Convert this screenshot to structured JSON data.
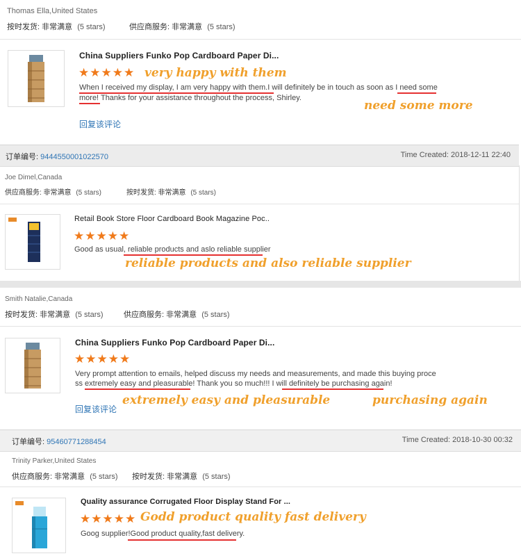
{
  "review1": {
    "user": "Thomas Ella,United States",
    "meta_a_label": "按时发货: 非常满意",
    "meta_a_stars": "(5 stars)",
    "meta_b_label": "供应商服务: 非常满意",
    "meta_b_stars": "(5 stars)",
    "product_title": "China Suppliers Funko Pop Cardboard Paper Di...",
    "stars": "★★★★★",
    "review_line1": "When I received my display, I am very happy with them.I will definitely be in touch as soon as I need some",
    "review_line2": "more! Thanks for your assistance throughout the process, Shirley.",
    "annotation_a": "very happy with them",
    "annotation_b": "need  some more",
    "reply": "回复该评论"
  },
  "order1": {
    "order_label": "订单编号:",
    "order_no": "9444550001022570",
    "time": "Time Created: 2018-12-11 22:40"
  },
  "review2": {
    "user": "Joe Dimel,Canada",
    "meta_a_label": "供应商服务: 非常满意",
    "meta_a_stars": "(5 stars)",
    "meta_b_label": "按时发货: 非常满意",
    "meta_b_stars": "(5 stars)",
    "product_title": "Retail Book Store Floor Cardboard Book Magazine Poc..",
    "stars": "★★★★★",
    "review_line1": "Good as usual, reliable products and aslo reliable supplier",
    "annotation_a": "reliable products and also reliable supplier"
  },
  "review3": {
    "user": "Smith Natalie,Canada",
    "meta_a_label": "按时发货: 非常满意",
    "meta_a_stars": "(5 stars)",
    "meta_b_label": "供应商服务: 非常满意",
    "meta_b_stars": "(5 stars)",
    "product_title": "China Suppliers Funko Pop Cardboard Paper Di...",
    "stars": "★★★★★",
    "review_line1": "Very prompt attention to emails, helped discuss my needs and measurements, and made this buying proce",
    "review_line2": "ss extremely easy and pleasurable! Thank you so much!!! I will definitely be purchasing again!",
    "annotation_a": "extremely easy and pleasurable",
    "annotation_b": "purchasing again",
    "reply": "回复该评论"
  },
  "order2": {
    "order_label": "订单编号:",
    "order_no": "95460771288454",
    "time": "Time Created: 2018-10-30 00:32"
  },
  "review4": {
    "user": "Trinity Parker,United States",
    "meta_a_label": "供应商服务: 非常满意",
    "meta_a_stars": "(5 stars)",
    "meta_b_label": "按时发货: 非常满意",
    "meta_b_stars": "(5 stars)",
    "product_title": "Quality assurance Corrugated Floor Display Stand For ...",
    "stars": "★★★★★",
    "review_line1": "Goog supplier!Good product quality,fast delivery.",
    "annotation_a": "Godd product quality fast delivery"
  },
  "colors": {
    "accent_link": "#2f75b5",
    "stars": "#f07a1a",
    "annotation": "#f0a02c",
    "underline": "#e53030"
  }
}
